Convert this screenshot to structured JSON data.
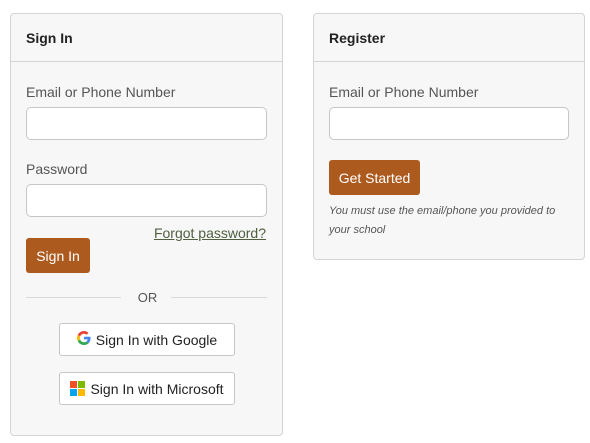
{
  "signin": {
    "title": "Sign In",
    "email_label": "Email or Phone Number",
    "email_value": "",
    "password_label": "Password",
    "password_value": "",
    "forgot_link": "Forgot password?",
    "submit_label": "Sign In",
    "or_text": "OR",
    "google_label": "Sign In with Google",
    "google_icon": "google-g-icon",
    "microsoft_label": "Sign In with Microsoft",
    "microsoft_icon": "microsoft-logo-icon"
  },
  "register": {
    "title": "Register",
    "email_label": "Email or Phone Number",
    "email_value": "",
    "submit_label": "Get Started",
    "hint": "You must use the email/phone you provided to your school"
  },
  "colors": {
    "accent": "#ad5a1f",
    "link": "#4f5f40",
    "card_background": "#f7f7f7",
    "border": "#d4d4d4"
  }
}
